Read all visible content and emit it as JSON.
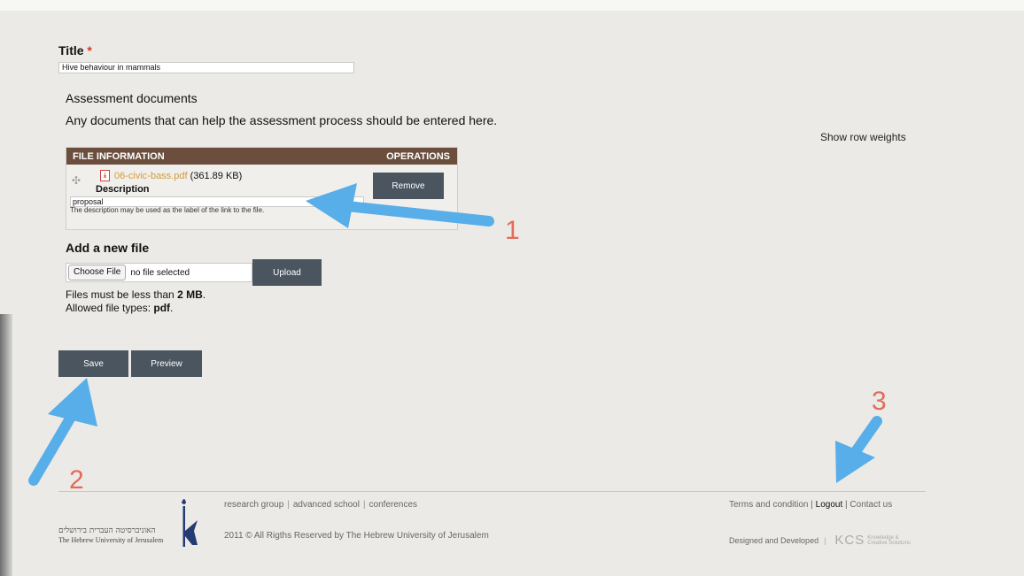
{
  "title": {
    "label": "Title",
    "required_mark": "*",
    "value": "Hive behaviour in mammals"
  },
  "assessment": {
    "heading": "Assessment documents",
    "description": "Any documents that can help the assessment process should be entered here.",
    "row_weights_link": "Show row weights"
  },
  "file_table": {
    "col_info": "FILE INFORMATION",
    "col_ops": "OPERATIONS",
    "rows": [
      {
        "file_name": "06-civic-bass.pdf",
        "file_size": "(361.89 KB)",
        "description_label": "Description",
        "description_value": "proposal",
        "description_hint": "The description may be used as the label of the link to the file.",
        "remove_label": "Remove"
      }
    ]
  },
  "add_file": {
    "heading": "Add a new file",
    "choose_label": "Choose File",
    "no_file_text": "no file selected",
    "upload_label": "Upload",
    "size_prefix": "Files must be less than ",
    "size_value": "2 MB",
    "size_suffix": ".",
    "types_prefix": "Allowed file types: ",
    "types_value": "pdf",
    "types_suffix": "."
  },
  "actions": {
    "save_label": "Save",
    "preview_label": "Preview"
  },
  "footer": {
    "links": [
      "research group",
      "advanced school",
      "conferences"
    ],
    "copyright": "2011 © All Rigths Reserved by The Hebrew University of Jerusalem",
    "right_links": {
      "terms": "Terms and condition",
      "logout": "Logout",
      "contact": "Contact us"
    },
    "designed": "Designed and Developed",
    "kcs_logo": "KCS",
    "kcs_sub": "Knowledge & Creative Solutions",
    "university_he": "האוניברסיטה העברית בירושלים",
    "university_en": "The Hebrew University of Jerusalem"
  },
  "annotations": {
    "n1": "1",
    "n2": "2",
    "n3": "3",
    "arrow_color": "#58aee8",
    "number_color": "#e36b59"
  },
  "colors": {
    "table_header": "#6b4e3d",
    "button": "#4a5560",
    "file_link": "#d49b3c",
    "page_bg": "#ebeae6"
  }
}
